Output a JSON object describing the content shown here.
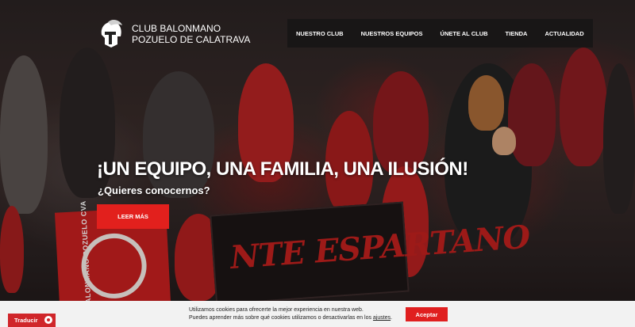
{
  "club": {
    "name_line1": "CLUB BALONMANO",
    "name_line2": "POZUELO DE CALATRAVA",
    "logo_icon": "spartan-helmet-icon"
  },
  "nav": {
    "items": [
      {
        "label": "NUESTRO CLUB"
      },
      {
        "label": "NUESTROS EQUIPOS"
      },
      {
        "label": "ÚNETE AL CLUB"
      },
      {
        "label": "TIENDA"
      },
      {
        "label": "ACTUALIDAD"
      }
    ]
  },
  "hero": {
    "headline": "¡UN EQUIPO, UNA FAMILIA, UNA ILUSIÓN!",
    "subheadline": "¿Quieres conocernos?",
    "cta_label": "LEER MÁS",
    "banner_text": "NTE ESPARTANO",
    "flag_text": "BALONMANO POZUELO CVA"
  },
  "cookie": {
    "line1": "Utilizamos cookies para ofrecerte la mejor experiencia en nuestra web.",
    "line2_prefix": "Puedes aprender más sobre qué cookies utilizamos o desactivarlas en los",
    "settings_link": "ajustes",
    "line2_suffix": ".",
    "accept_label": "Aceptar"
  },
  "translate": {
    "label": "Traducir",
    "icon": "translate-icon"
  },
  "colors": {
    "accent": "#e2201d",
    "nav_bg": "#141414",
    "cookie_bg": "#f2f2f2"
  }
}
